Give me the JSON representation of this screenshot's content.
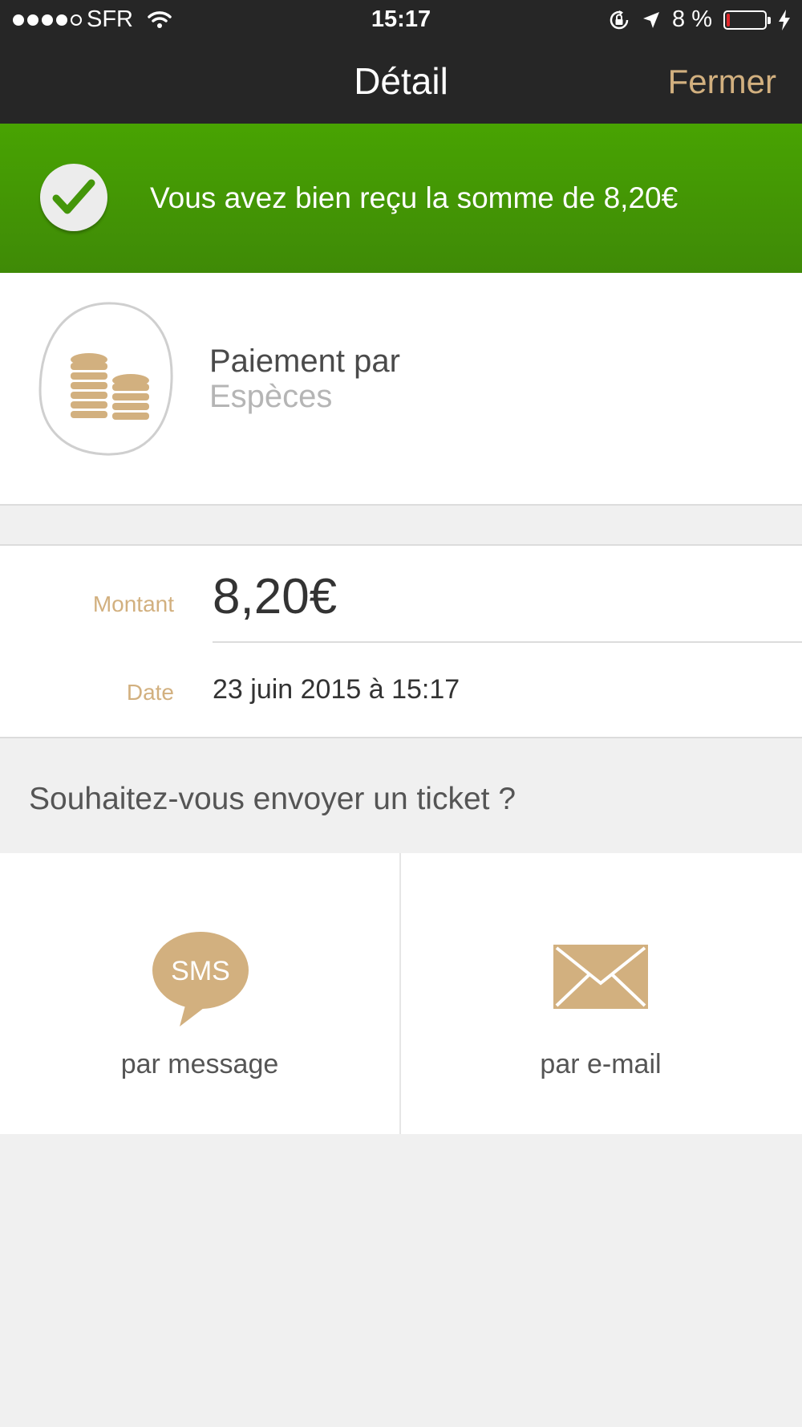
{
  "status_bar": {
    "carrier": "SFR",
    "time": "15:17",
    "battery_text": "8 %",
    "battery_level": 0.08,
    "signal_bars": 4
  },
  "nav": {
    "title": "Détail",
    "close_label": "Fermer"
  },
  "banner": {
    "message": "Vous avez bien reçu la somme de 8,20€",
    "color": "#48a302"
  },
  "payment": {
    "label": "Paiement par",
    "method": "Espèces"
  },
  "details": {
    "amount_label": "Montant",
    "amount_value": "8,20€",
    "date_label": "Date",
    "date_value": "23 juin 2015 à 15:17"
  },
  "ticket": {
    "question": "Souhaitez-vous envoyer un ticket ?",
    "sms_icon_text": "SMS",
    "sms_label": "par message",
    "email_label": "par e-mail"
  },
  "colors": {
    "accent": "#d2b07f",
    "navbar": "#262626",
    "background": "#f0f0f0"
  }
}
